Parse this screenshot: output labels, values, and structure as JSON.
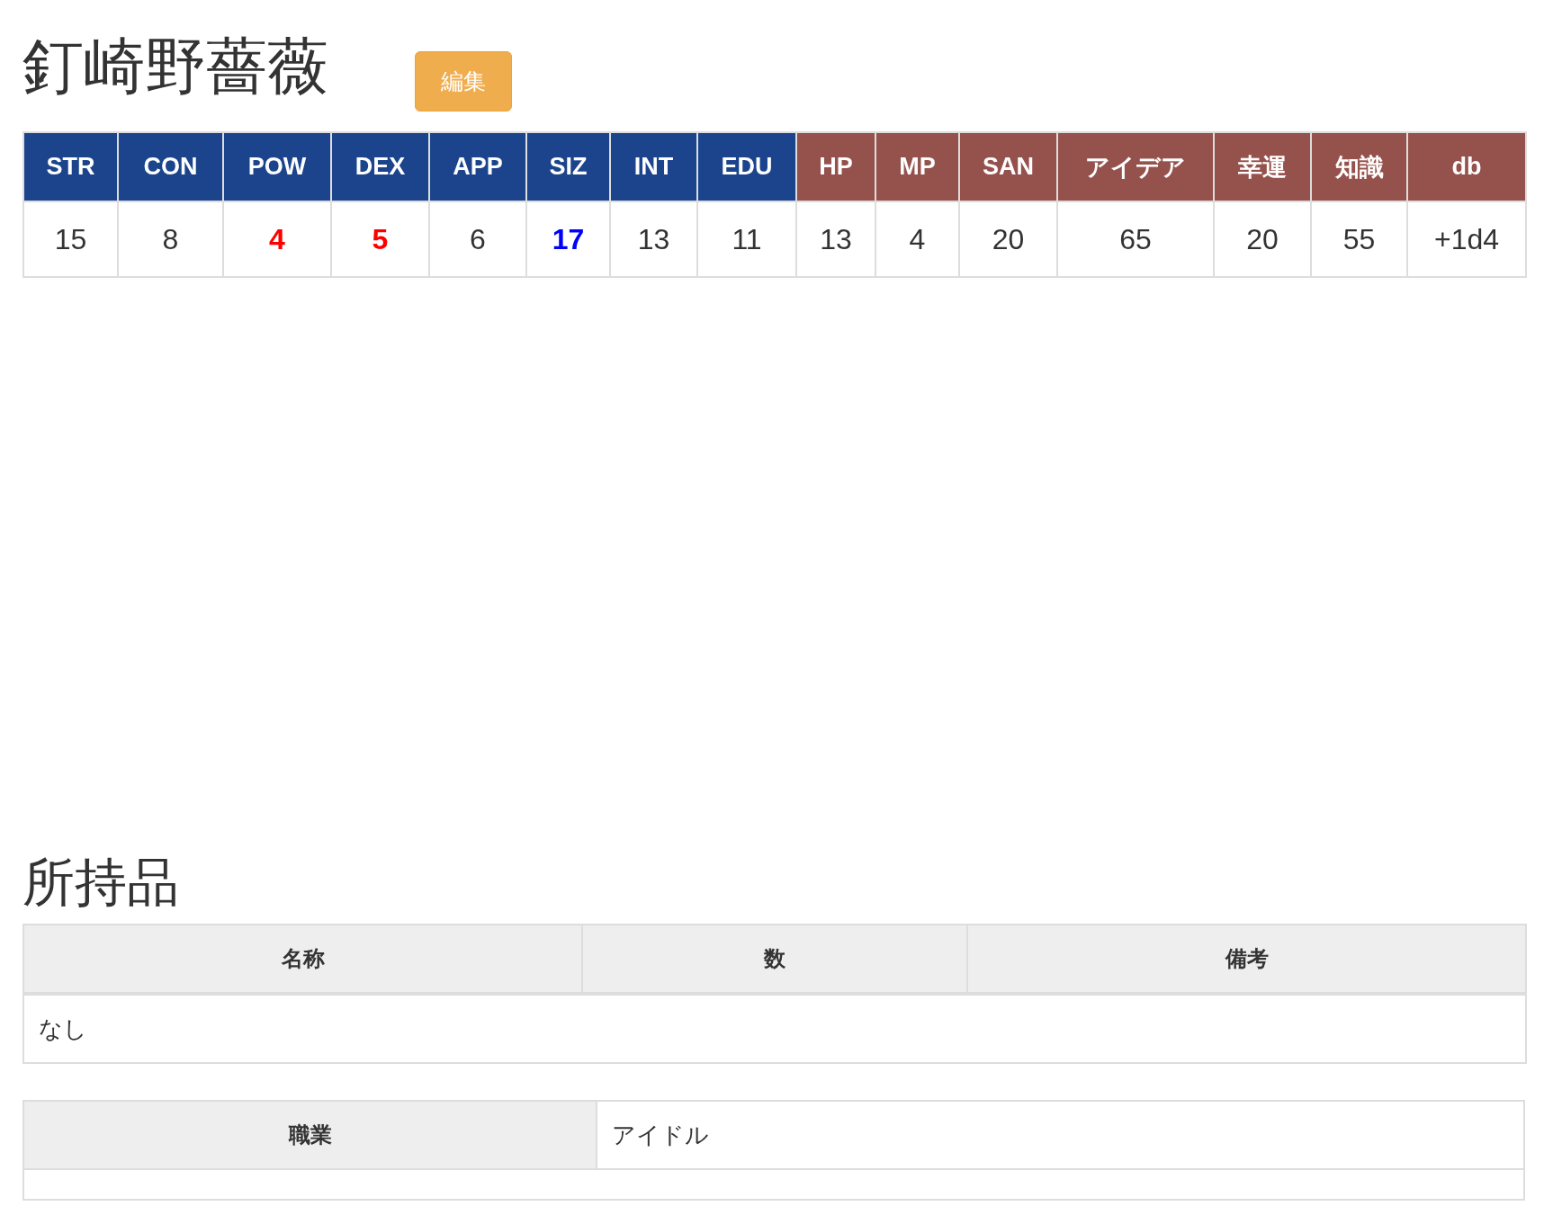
{
  "character": {
    "name": "釘崎野薔薇",
    "edit_button": "編集"
  },
  "stats": {
    "columns": [
      {
        "label": "STR",
        "kind": "base",
        "value": "15",
        "color": "#333333",
        "bold": false
      },
      {
        "label": "CON",
        "kind": "base",
        "value": "8",
        "color": "#333333",
        "bold": false
      },
      {
        "label": "POW",
        "kind": "base",
        "value": "4",
        "color": "#ff0000",
        "bold": true
      },
      {
        "label": "DEX",
        "kind": "base",
        "value": "5",
        "color": "#ff0000",
        "bold": true
      },
      {
        "label": "APP",
        "kind": "base",
        "value": "6",
        "color": "#333333",
        "bold": false
      },
      {
        "label": "SIZ",
        "kind": "base",
        "value": "17",
        "color": "#0000ff",
        "bold": true
      },
      {
        "label": "INT",
        "kind": "base",
        "value": "13",
        "color": "#333333",
        "bold": false
      },
      {
        "label": "EDU",
        "kind": "base",
        "value": "11",
        "color": "#333333",
        "bold": false
      },
      {
        "label": "HP",
        "kind": "derived",
        "value": "13",
        "color": "#333333",
        "bold": false
      },
      {
        "label": "MP",
        "kind": "derived",
        "value": "4",
        "color": "#333333",
        "bold": false
      },
      {
        "label": "SAN",
        "kind": "derived",
        "value": "20",
        "color": "#333333",
        "bold": false
      },
      {
        "label": "アイデア",
        "kind": "derived",
        "value": "65",
        "color": "#333333",
        "bold": false
      },
      {
        "label": "幸運",
        "kind": "derived",
        "value": "20",
        "color": "#333333",
        "bold": false
      },
      {
        "label": "知識",
        "kind": "derived",
        "value": "55",
        "color": "#333333",
        "bold": false
      },
      {
        "label": "db",
        "kind": "derived",
        "value": "+1d4",
        "color": "#333333",
        "bold": false
      }
    ]
  },
  "inventory": {
    "title": "所持品",
    "columns": [
      "名称",
      "数",
      "備考"
    ],
    "empty_text": "なし"
  },
  "profile": {
    "rows": [
      {
        "label": "職業",
        "value": "アイドル"
      }
    ]
  }
}
